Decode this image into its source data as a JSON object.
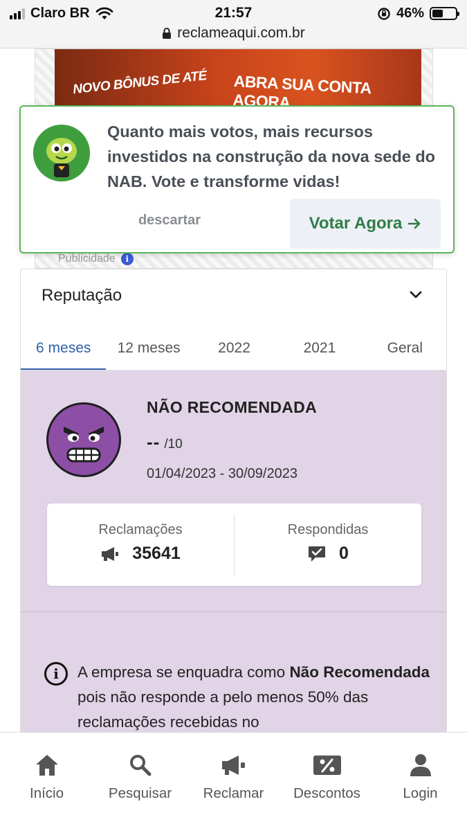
{
  "status_bar": {
    "carrier": "Claro BR",
    "time": "21:57",
    "battery_percent": "46%",
    "battery_level": 0.46,
    "url": "reclameaqui.com.br"
  },
  "ad": {
    "text_left": "NOVO BÔNUS DE ATÉ",
    "text_right": "ABRA SUA CONTA AGORA",
    "label": "Publicidade"
  },
  "popup": {
    "message": "Quanto mais votos, mais recursos investidos na construção da nova sede do NAB. Vote e transforme vidas!",
    "dismiss_label": "descartar",
    "vote_label": "Votar Agora"
  },
  "reputation": {
    "title": "Reputação",
    "tabs": [
      {
        "label": "6 meses",
        "active": true
      },
      {
        "label": "12 meses",
        "active": false
      },
      {
        "label": "2022",
        "active": false
      },
      {
        "label": "2021",
        "active": false
      },
      {
        "label": "Geral",
        "active": false
      }
    ],
    "status": "NÃO RECOMENDADA",
    "score": "--",
    "score_max": "/10",
    "period": "01/04/2023 - 30/09/2023",
    "stats": {
      "complaints_label": "Reclamações",
      "complaints_value": "35641",
      "answered_label": "Respondidas",
      "answered_value": "0"
    },
    "explanation": {
      "prefix": "A empresa se enquadra como ",
      "bold": "Não Recomendada",
      "suffix": " pois não responde a pelo menos 50% das reclamações recebidas no"
    }
  },
  "bottom_nav": [
    {
      "label": "Início",
      "icon": "home-icon"
    },
    {
      "label": "Pesquisar",
      "icon": "search-icon"
    },
    {
      "label": "Reclamar",
      "icon": "megaphone-icon"
    },
    {
      "label": "Descontos",
      "icon": "discount-icon"
    },
    {
      "label": "Login",
      "icon": "user-icon"
    }
  ],
  "colors": {
    "accent_green": "#2e7d46",
    "popup_border": "#5ab65a",
    "active_tab": "#2f5ea8",
    "reputation_bg": "#e0d4e6",
    "angry_face": "#8d4fa6"
  }
}
